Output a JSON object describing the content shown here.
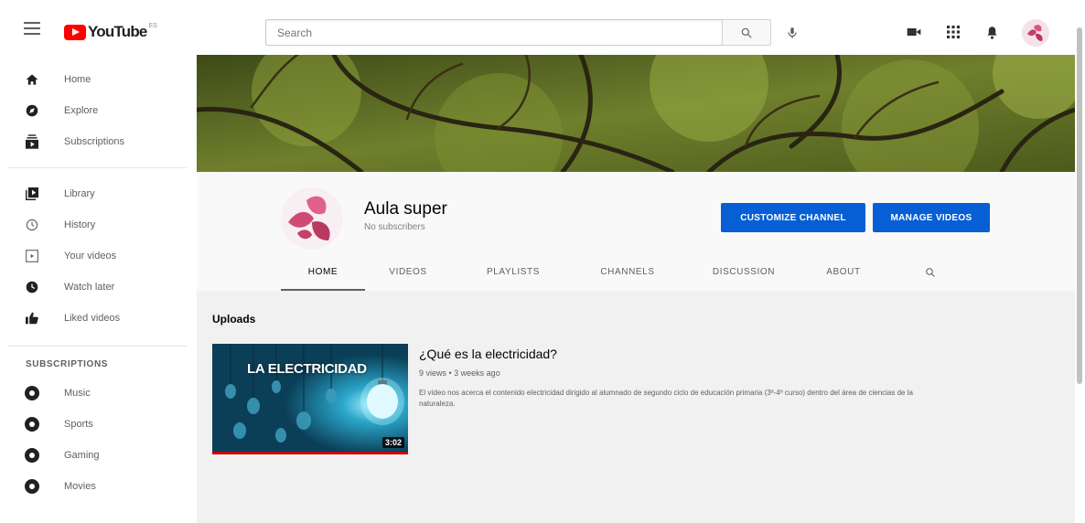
{
  "header": {
    "logo_text": "YouTube",
    "logo_superscript": "ES",
    "search_placeholder": "Search"
  },
  "sidebar": {
    "main_items": [
      {
        "label": "Home",
        "icon": "home-icon"
      },
      {
        "label": "Explore",
        "icon": "compass-icon"
      },
      {
        "label": "Subscriptions",
        "icon": "subscriptions-icon"
      }
    ],
    "library_items": [
      {
        "label": "Library",
        "icon": "library-icon"
      },
      {
        "label": "History",
        "icon": "history-icon"
      },
      {
        "label": "Your videos",
        "icon": "your-videos-icon"
      },
      {
        "label": "Watch later",
        "icon": "watch-later-icon"
      },
      {
        "label": "Liked videos",
        "icon": "thumbs-up-icon"
      }
    ],
    "subscriptions_heading": "SUBSCRIPTIONS",
    "subscriptions": [
      {
        "label": "Music"
      },
      {
        "label": "Sports"
      },
      {
        "label": "Gaming"
      },
      {
        "label": "Movies"
      }
    ]
  },
  "channel": {
    "name": "Aula super",
    "subscribers": "No subscribers",
    "customize_label": "CUSTOMIZE CHANNEL",
    "manage_label": "MANAGE VIDEOS",
    "tabs": [
      "HOME",
      "VIDEOS",
      "PLAYLISTS",
      "CHANNELS",
      "DISCUSSION",
      "ABOUT"
    ],
    "active_tab": "HOME"
  },
  "uploads": {
    "heading": "Uploads",
    "video": {
      "thumbnail_title": "LA ELECTRICIDAD",
      "duration": "3:02",
      "title": "¿Qué es la electricidad?",
      "meta": "9 views • 3 weeks ago",
      "description": "El vídeo nos acerca el contenido electricidad dirigido al alumnado de segundo ciclo de educación primaria (3º-4º curso) dentro del área de ciencias de la naturaleza."
    }
  },
  "colors": {
    "brand_red": "#ff0000",
    "button_blue": "#065fd4",
    "progress_red": "#cc0000"
  }
}
